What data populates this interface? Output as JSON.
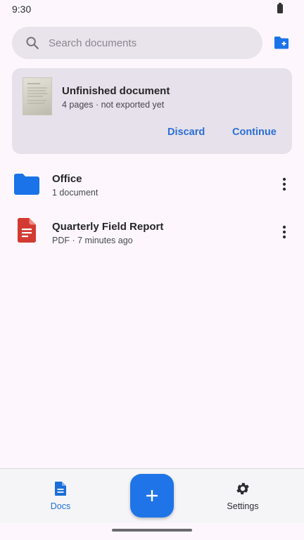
{
  "status_bar": {
    "time": "9:30"
  },
  "search": {
    "placeholder": "Search documents",
    "value": ""
  },
  "draft_card": {
    "title": "Unfinished document",
    "subtitle": "4 pages · not exported yet",
    "discard_label": "Discard",
    "continue_label": "Continue"
  },
  "items": [
    {
      "title": "Office",
      "subtitle": "1 document",
      "icon": "folder-icon"
    },
    {
      "title": "Quarterly Field Report",
      "subtitle": "PDF · 7 minutes ago",
      "icon": "pdf-document-icon"
    }
  ],
  "nav": {
    "docs_label": "Docs",
    "settings_label": "Settings",
    "active": "docs"
  },
  "colors": {
    "accent": "#1f74e8",
    "folder": "#1a73e8",
    "pdf": "#d23a32",
    "background": "#fdf7fd",
    "card": "#e6e1ea"
  }
}
